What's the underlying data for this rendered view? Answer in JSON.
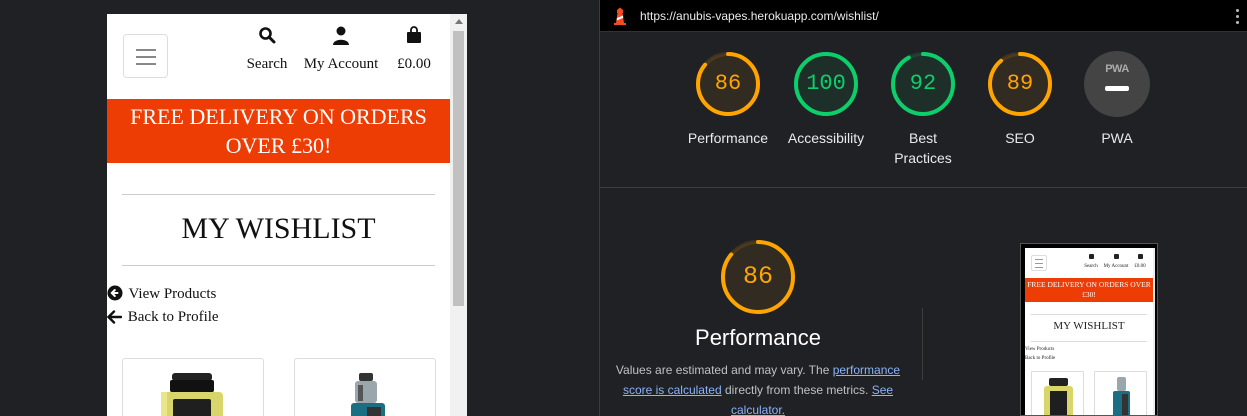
{
  "mobile": {
    "nav": {
      "search_label": "Search",
      "account_label": "My Account",
      "bag_total": "£0.00"
    },
    "promo_banner": "FREE DELIVERY ON ORDERS OVER £30!",
    "page_title": "MY WISHLIST",
    "links": {
      "view_products": "View Products",
      "back_to_profile": "Back to Profile"
    }
  },
  "lighthouse": {
    "url": "https://anubis-vapes.herokuapp.com/wishlist/",
    "gauges": [
      {
        "label": "Performance",
        "score": "86",
        "value": 86,
        "color": "#ffa400"
      },
      {
        "label": "Accessibility",
        "score": "100",
        "value": 100,
        "color": "#0cce6b"
      },
      {
        "label": "Best Practices",
        "score": "92",
        "value": 92,
        "color": "#0cce6b"
      },
      {
        "label": "SEO",
        "score": "89",
        "value": 89,
        "color": "#ffa400"
      },
      {
        "label": "PWA",
        "badge_text": "PWA"
      }
    ],
    "detail": {
      "score": "86",
      "value": 86,
      "title": "Performance",
      "desc_prefix": "Values are estimated and may vary. The ",
      "desc_link1": "performance score is calculated",
      "desc_middle": " directly from these metrics. ",
      "desc_link2": "See calculator."
    },
    "thumbnail": {
      "promo_banner": "FREE DELIVERY ON ORDERS OVER £30!",
      "page_title": "MY WISHLIST",
      "nav_search": "Search",
      "nav_account": "My Account",
      "nav_bag": "£0.00",
      "link_view_products": "View Products",
      "link_back_profile": "Back to Profile"
    }
  },
  "colors": {
    "brand_orange": "#ee3c05",
    "score_orange": "#ffa400",
    "score_green": "#0cce6b",
    "link_blue": "#8ab4f8"
  }
}
